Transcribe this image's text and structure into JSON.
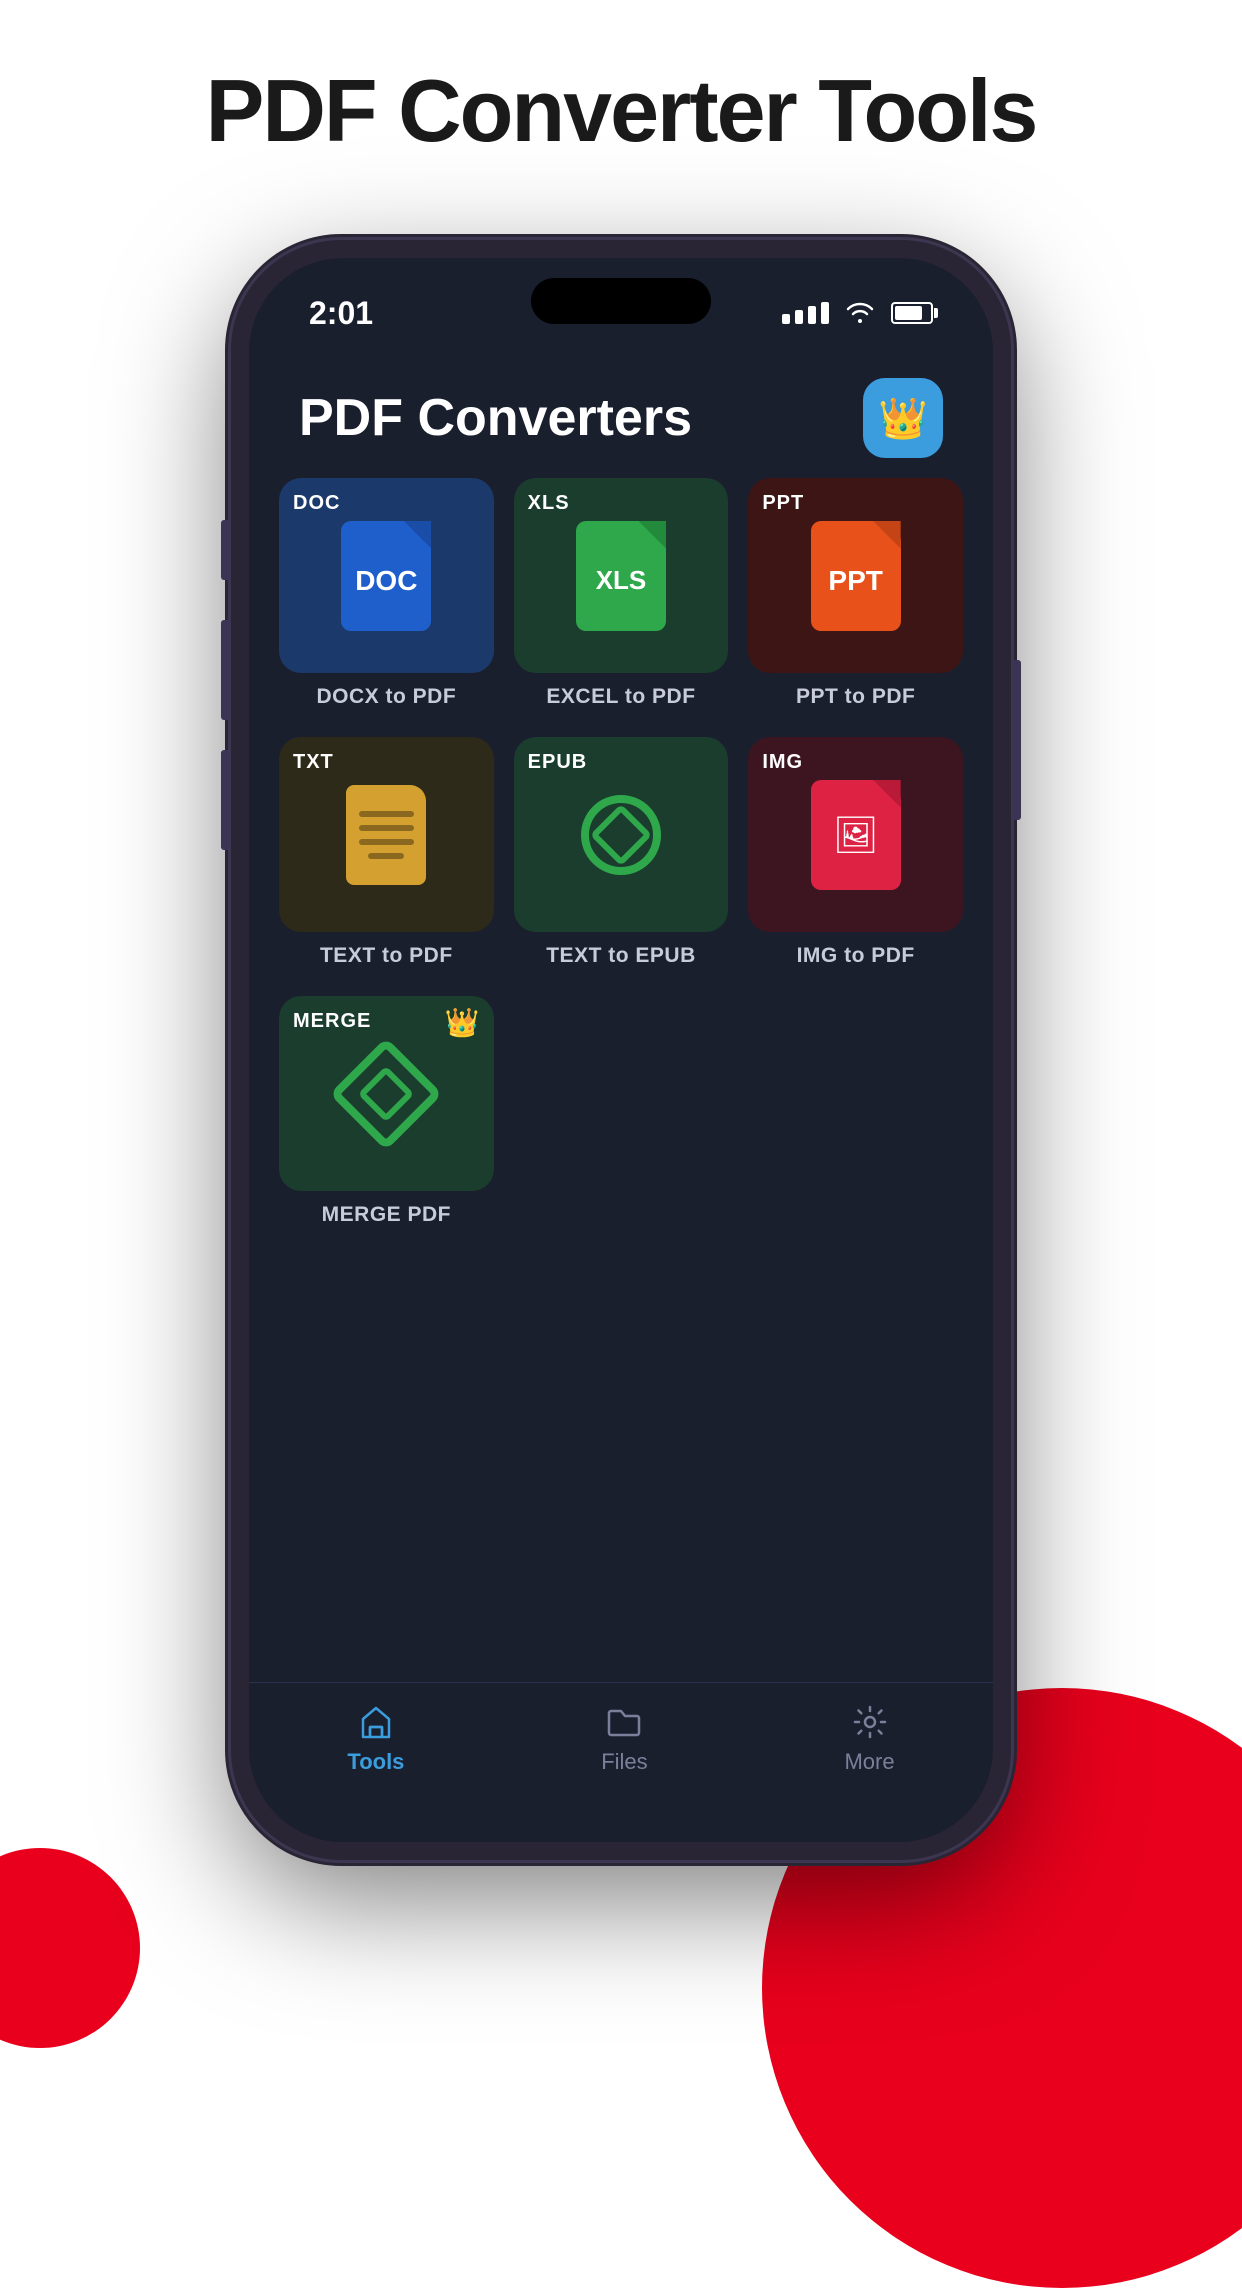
{
  "page": {
    "title": "PDF Converter Tools",
    "background": "#ffffff"
  },
  "phone": {
    "status_bar": {
      "time": "2:01",
      "wifi": true,
      "battery": 80
    },
    "header": {
      "title": "PDF Converters",
      "crown_button": "👑"
    },
    "grid": {
      "items": [
        {
          "badge": "DOC",
          "label": "DOCX to PDF",
          "bg_class": "bg-doc",
          "icon_type": "doc",
          "premium": false
        },
        {
          "badge": "XLS",
          "label": "EXCEL to PDF",
          "bg_class": "bg-xls",
          "icon_type": "xls",
          "premium": false
        },
        {
          "badge": "PPT",
          "label": "PPT to PDF",
          "bg_class": "bg-ppt",
          "icon_type": "ppt",
          "premium": false
        },
        {
          "badge": "TXT",
          "label": "TEXT to PDF",
          "bg_class": "bg-txt",
          "icon_type": "txt",
          "premium": false
        },
        {
          "badge": "EPUB",
          "label": "TEXT to EPUB",
          "bg_class": "bg-epub",
          "icon_type": "epub",
          "premium": false
        },
        {
          "badge": "IMG",
          "label": "IMG to PDF",
          "bg_class": "bg-img",
          "icon_type": "img",
          "premium": false
        },
        {
          "badge": "MERGE",
          "label": "MERGE PDF",
          "bg_class": "bg-merge",
          "icon_type": "merge",
          "premium": true
        }
      ]
    },
    "nav": {
      "items": [
        {
          "label": "Tools",
          "icon": "tools",
          "active": true
        },
        {
          "label": "Files",
          "icon": "files",
          "active": false
        },
        {
          "label": "More",
          "icon": "more",
          "active": false
        }
      ]
    }
  }
}
